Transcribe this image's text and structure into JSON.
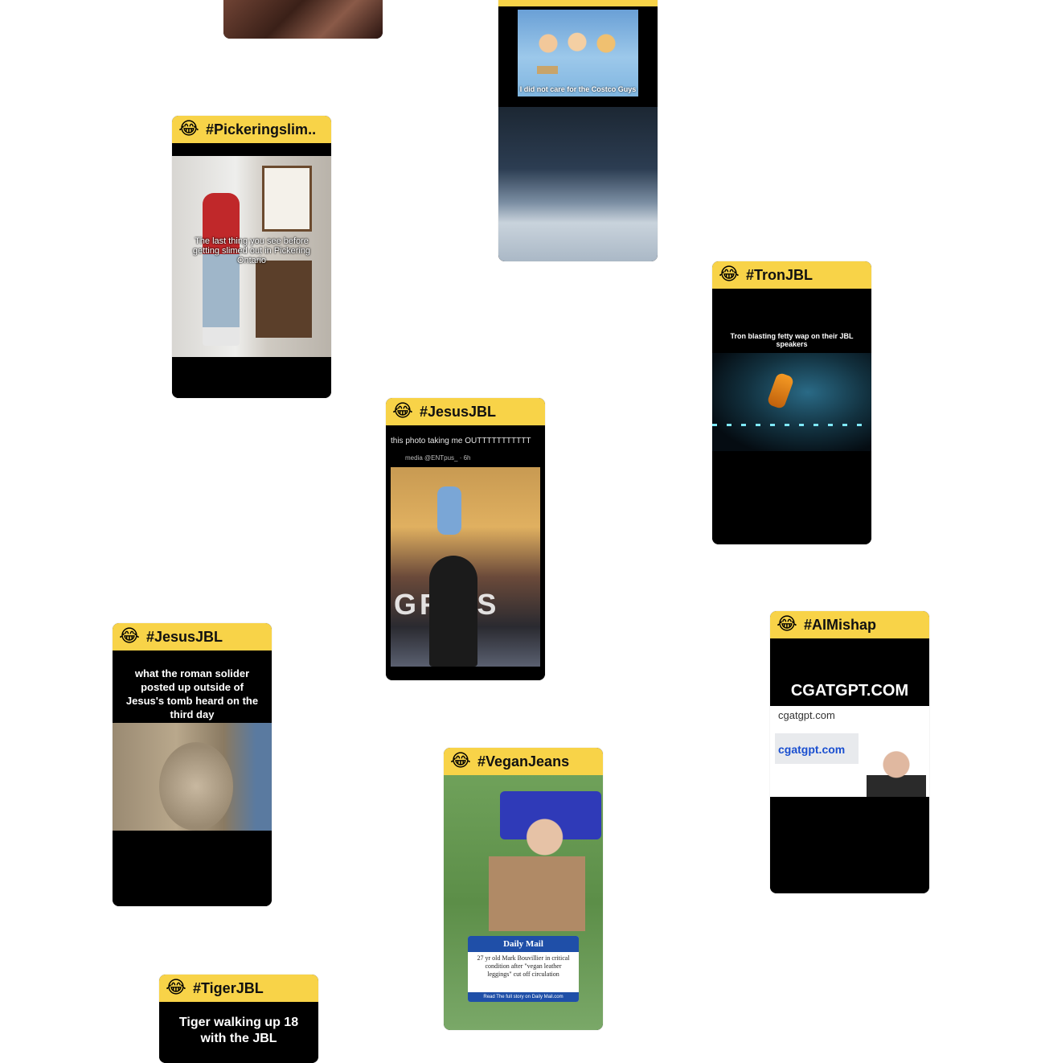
{
  "emoji": "😂",
  "cards": {
    "pickering": {
      "tag": "#Pickeringslim..",
      "caption": "The last thing you see before getting slimed out in Pickering Ontario"
    },
    "costco": {
      "caption": "I did not care for the Costco Guys"
    },
    "tron": {
      "tag": "#TronJBL",
      "caption": "Tron blasting fetty wap on their JBL speakers"
    },
    "jesus1": {
      "tag": "#JesusJBL",
      "post_text": "this photo taking me OUTTTTTTTTTTT",
      "media_handle": "media @ENTpus_ · 6h",
      "stage_text": "GR  YS"
    },
    "jesus2": {
      "tag": "#JesusJBL",
      "caption": "what the roman solider posted up outside of Jesus's tomb heard on the third day"
    },
    "aimishap": {
      "tag": "#AIMishap",
      "headline": "CGATGPT.COM",
      "url_text": "cgatgpt.com",
      "link_text": "cgatgpt.com"
    },
    "vegan": {
      "tag": "#VeganJeans",
      "source": "Daily Mail",
      "news_text": "27 yr old Mark Bouvillier in critical condition after \"vegan leather leggings\" cut off circulation",
      "news_footer": "Read The full story on Daily Mail.com"
    },
    "tiger": {
      "tag": "#TigerJBL",
      "caption": "Tiger walking up 18 with the JBL"
    }
  },
  "colors": {
    "header": "#f8d348",
    "card_bg": "#000000"
  }
}
